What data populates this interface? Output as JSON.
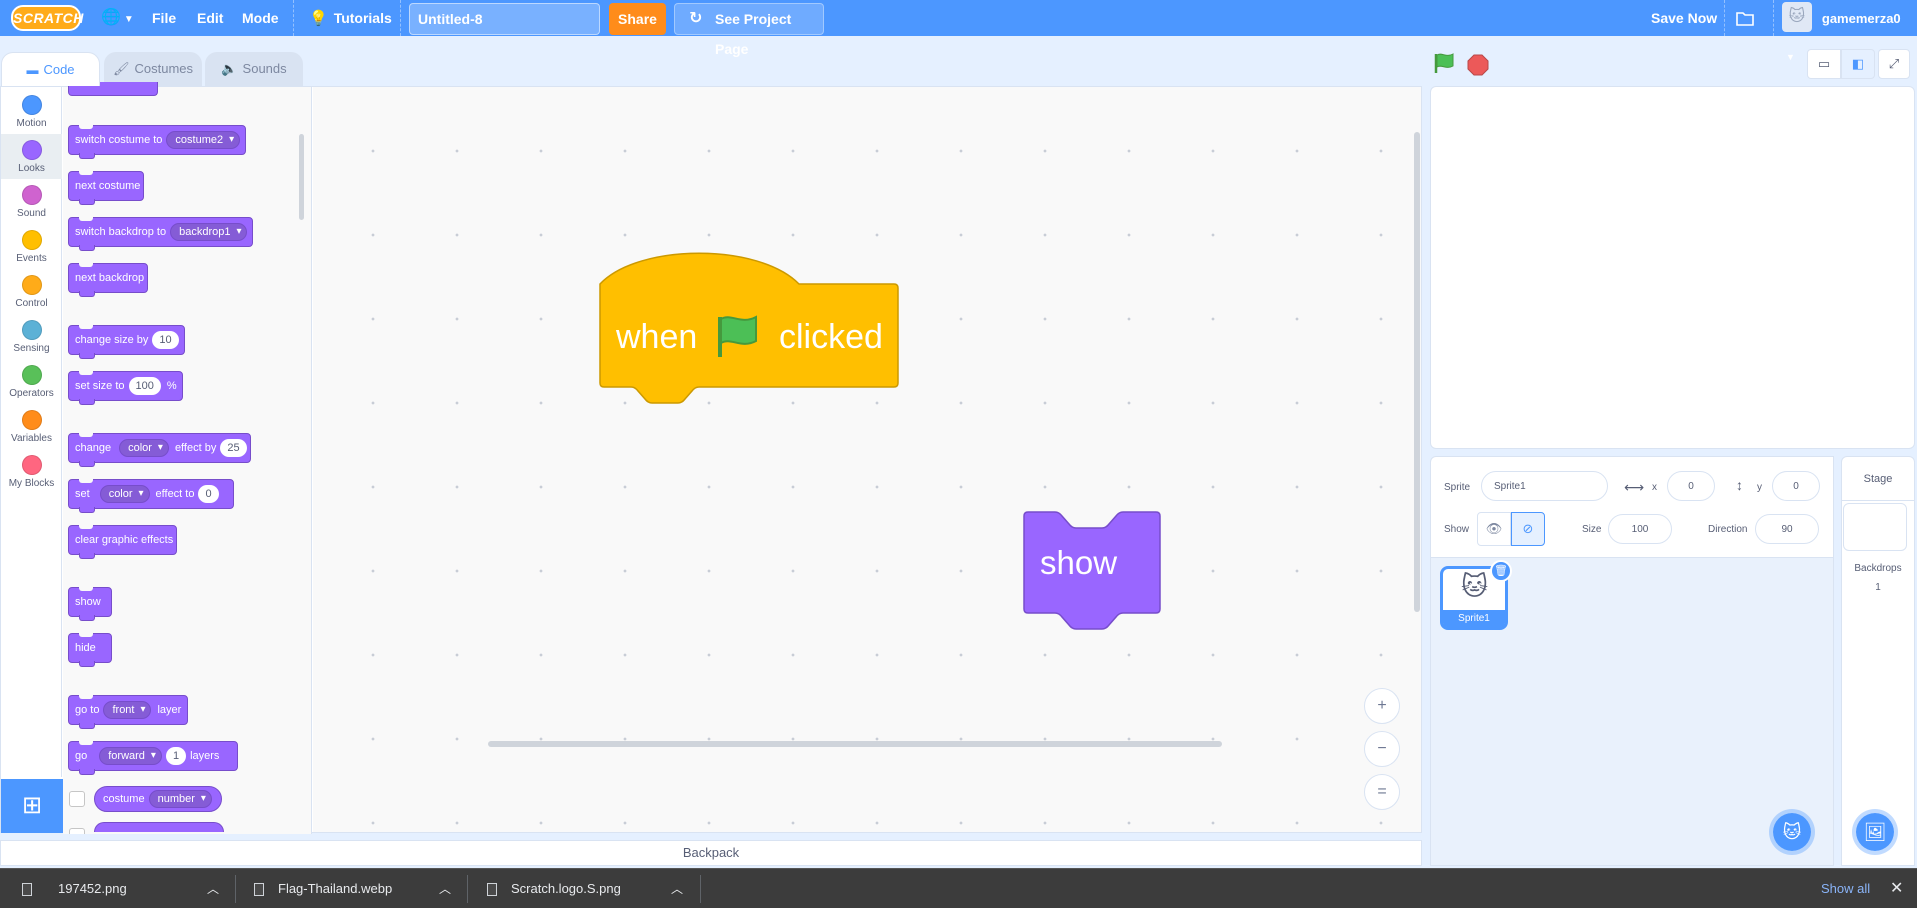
{
  "menubar": {
    "logo": "SCRATCH",
    "file": "File",
    "edit": "Edit",
    "mode": "Mode",
    "tutorials": "Tutorials",
    "project_title": "Untitled-8",
    "share": "Share",
    "see_project_page": "See Project Page",
    "save_now": "Save Now",
    "username": "gamemerza0",
    "accent_color": "#4c97ff"
  },
  "tabs": [
    "Code",
    "Costumes",
    "Sounds"
  ],
  "categories": [
    {
      "label": "Motion",
      "color": "#4c97ff"
    },
    {
      "label": "Looks",
      "color": "#9966ff"
    },
    {
      "label": "Sound",
      "color": "#cf63cf"
    },
    {
      "label": "Events",
      "color": "#ffbf00"
    },
    {
      "label": "Control",
      "color": "#ffab19"
    },
    {
      "label": "Sensing",
      "color": "#5cb1d6"
    },
    {
      "label": "Operators",
      "color": "#59c059"
    },
    {
      "label": "Variables",
      "color": "#ff8c1a"
    },
    {
      "label": "My Blocks",
      "color": "#ff6680"
    }
  ],
  "palette": {
    "switch_costume": "switch costume to",
    "costume2": "costume2",
    "next_costume": "next costume",
    "switch_backdrop": "switch backdrop to",
    "backdrop1": "backdrop1",
    "next_backdrop": "next backdrop",
    "change_size": "change size by",
    "size_step": "10",
    "set_size": "set size to",
    "size_value": "100",
    "percent": "%",
    "change": "change",
    "color": "color",
    "effect_by": "effect by",
    "effect_step": "25",
    "set": "set",
    "effect_to": "effect to",
    "effect_value": "0",
    "clear_effects": "clear graphic effects",
    "show": "show",
    "hide": "hide",
    "go_to": "go to",
    "front": "front",
    "layer": "layer",
    "go": "go",
    "forward": "forward",
    "layers_step": "1",
    "layers": "layers",
    "costume": "costume",
    "number": "number"
  },
  "script": {
    "hat_when": "when",
    "hat_clicked": "clicked",
    "show_block": "show"
  },
  "zoom": {
    "in": "+",
    "out": "−",
    "reset": "="
  },
  "backpack": "Backpack",
  "sprite_info": {
    "sprite_label": "Sprite",
    "sprite_name": "Sprite1",
    "x_label": "x",
    "x_value": "0",
    "y_label": "y",
    "y_value": "0",
    "show_label": "Show",
    "size_label": "Size",
    "size_value": "100",
    "direction_label": "Direction",
    "direction_value": "90"
  },
  "sprites": [
    {
      "name": "Sprite1"
    }
  ],
  "stage_panel": {
    "title": "Stage",
    "backdrops_label": "Backdrops",
    "backdrops_count": "1"
  },
  "downloads": [
    {
      "name": "197452.png"
    },
    {
      "name": "Flag-Thailand.webp"
    },
    {
      "name": "Scratch.logo.S.png"
    }
  ],
  "show_all": "Show all"
}
